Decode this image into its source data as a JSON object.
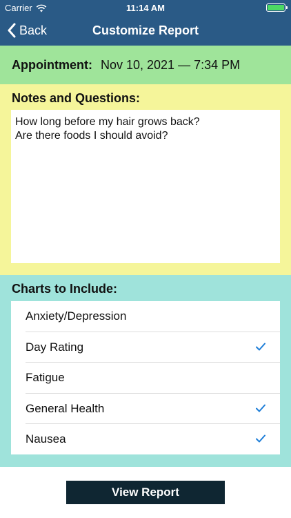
{
  "status_bar": {
    "carrier": "Carrier",
    "time": "11:14 AM",
    "wifi_icon": "wifi-icon",
    "battery_icon": "battery-icon"
  },
  "nav": {
    "back_label": "Back",
    "title": "Customize Report",
    "back_icon": "chevron-left-icon"
  },
  "appointment": {
    "label": "Appointment:",
    "value": "Nov 10, 2021 — 7:34 PM"
  },
  "notes": {
    "label": "Notes and Questions:",
    "text": "How long before my hair grows back?\nAre there foods I should avoid?"
  },
  "charts": {
    "label": "Charts to Include:",
    "items": [
      {
        "label": "Anxiety/Depression",
        "checked": false
      },
      {
        "label": "Day Rating",
        "checked": true
      },
      {
        "label": "Fatigue",
        "checked": false
      },
      {
        "label": "General Health",
        "checked": true
      },
      {
        "label": "Nausea",
        "checked": true
      }
    ]
  },
  "actions": {
    "view_report": "View Report"
  },
  "colors": {
    "navbar": "#2a5a86",
    "appointment_bg": "#9fe49a",
    "notes_bg": "#f5f59a",
    "charts_bg": "#9fe3db",
    "check": "#1e7ed8",
    "button_bg": "#0f2632"
  }
}
